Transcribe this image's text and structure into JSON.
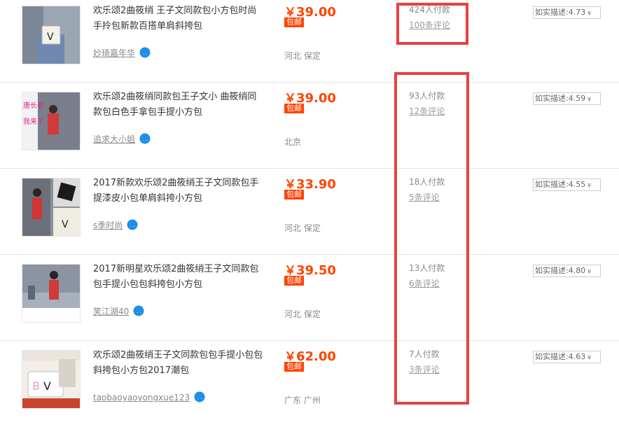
{
  "listings": [
    {
      "title": "欢乐颂2曲筱绡 王子文同款包小方包时尚手拎包新款百搭单肩斜挎包",
      "seller": "妙琦嘉年华",
      "price_yen": "￥",
      "price": "39.00",
      "post_badge": "包邮",
      "location": "河北 保定",
      "paid": "424人付款",
      "reviews": "100条评论",
      "rating": "如实描述:4.73"
    },
    {
      "title": "欢乐颂2曲筱绡同款包王子文小 曲筱绡同款包白色手拿包手提小方包",
      "seller": "追求大小姐",
      "price_yen": "￥",
      "price": "39.00",
      "post_badge": "包邮",
      "location": "北京",
      "paid": "93人付款",
      "reviews": "12条评论",
      "rating": "如实描述:4.59",
      "thumb_text": [
        "唐长老",
        "我来了"
      ]
    },
    {
      "title": "2017新款欢乐颂2曲筱绡王子文同款包手提漆皮小包单肩斜挎小方包",
      "seller": "s季时尚",
      "price_yen": "￥",
      "price": "33.90",
      "post_badge": "包邮",
      "location": "河北 保定",
      "paid": "18人付款",
      "reviews": "5条评论",
      "rating": "如实描述:4.55"
    },
    {
      "title": "2017新明星欢乐颂2曲筱绡王子文同款包包手提小包包斜挎包小方包",
      "seller": "笑江湖40",
      "price_yen": "￥",
      "price": "39.50",
      "post_badge": "包邮",
      "location": "河北 保定",
      "paid": "13人付款",
      "reviews": "6条评论",
      "rating": "如实描述:4.80"
    },
    {
      "title": "欢乐颂2曲筱绡王子文同款包包手提小包包斜挎包小方包2017潮包",
      "seller": "taobaoyaoyongxue123",
      "price_yen": "￥",
      "price": "62.00",
      "post_badge": "包邮",
      "location": "广东 广州",
      "paid": "7人付款",
      "reviews": "3条评论",
      "rating": "如实描述:4.63"
    }
  ],
  "colors": {
    "price": "#ff4400",
    "highlight": "#e94040",
    "separator": "#e6e6e6"
  },
  "icons": {
    "wangwang": "chat-bubble-icon",
    "dropdown": "chevron-down-icon"
  }
}
